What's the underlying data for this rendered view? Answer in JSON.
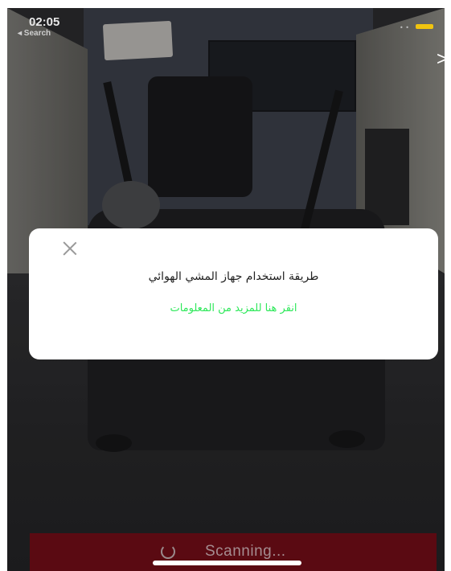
{
  "status_bar": {
    "time": "02:05",
    "back_label": "◂ Search"
  },
  "nav": {
    "next_glyph": ">"
  },
  "dialog": {
    "title": "طريقة استخدام جهاز المشي الهوائي",
    "link": "انقر هنا للمزيد من المعلومات",
    "link_color": "#2ee85a"
  },
  "scan": {
    "label": "Scanning...",
    "bar_color": "#5a0a12"
  },
  "accent": {
    "battery_color": "#f1c40f"
  }
}
